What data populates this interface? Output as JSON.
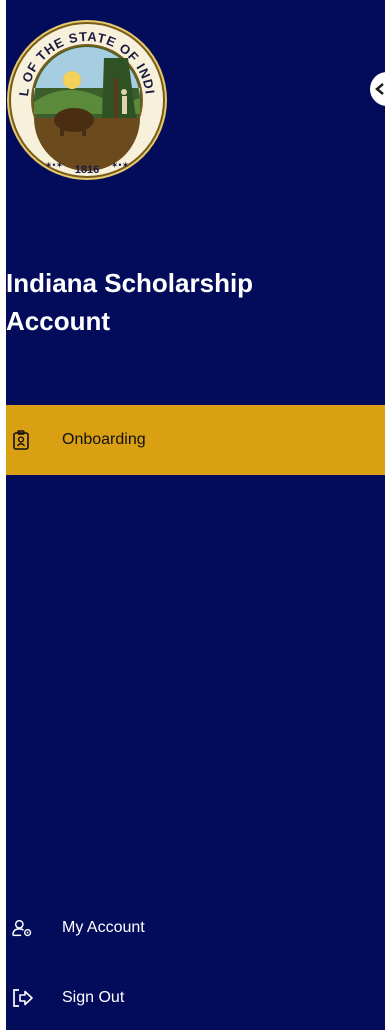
{
  "seal": {
    "top_text": "SEAL OF THE STATE OF INDIANA",
    "year": "1816"
  },
  "app_title": "Indiana Scholarship Account",
  "nav": {
    "items": [
      {
        "label": "Onboarding",
        "icon": "id-badge-icon",
        "active": true
      }
    ]
  },
  "footer": {
    "my_account": {
      "label": "My Account",
      "icon": "user-gear-icon"
    },
    "sign_out": {
      "label": "Sign Out",
      "icon": "sign-out-icon"
    }
  },
  "colors": {
    "sidebar_bg": "#030c5a",
    "active_bg": "#d8a012",
    "text": "#ffffff"
  }
}
